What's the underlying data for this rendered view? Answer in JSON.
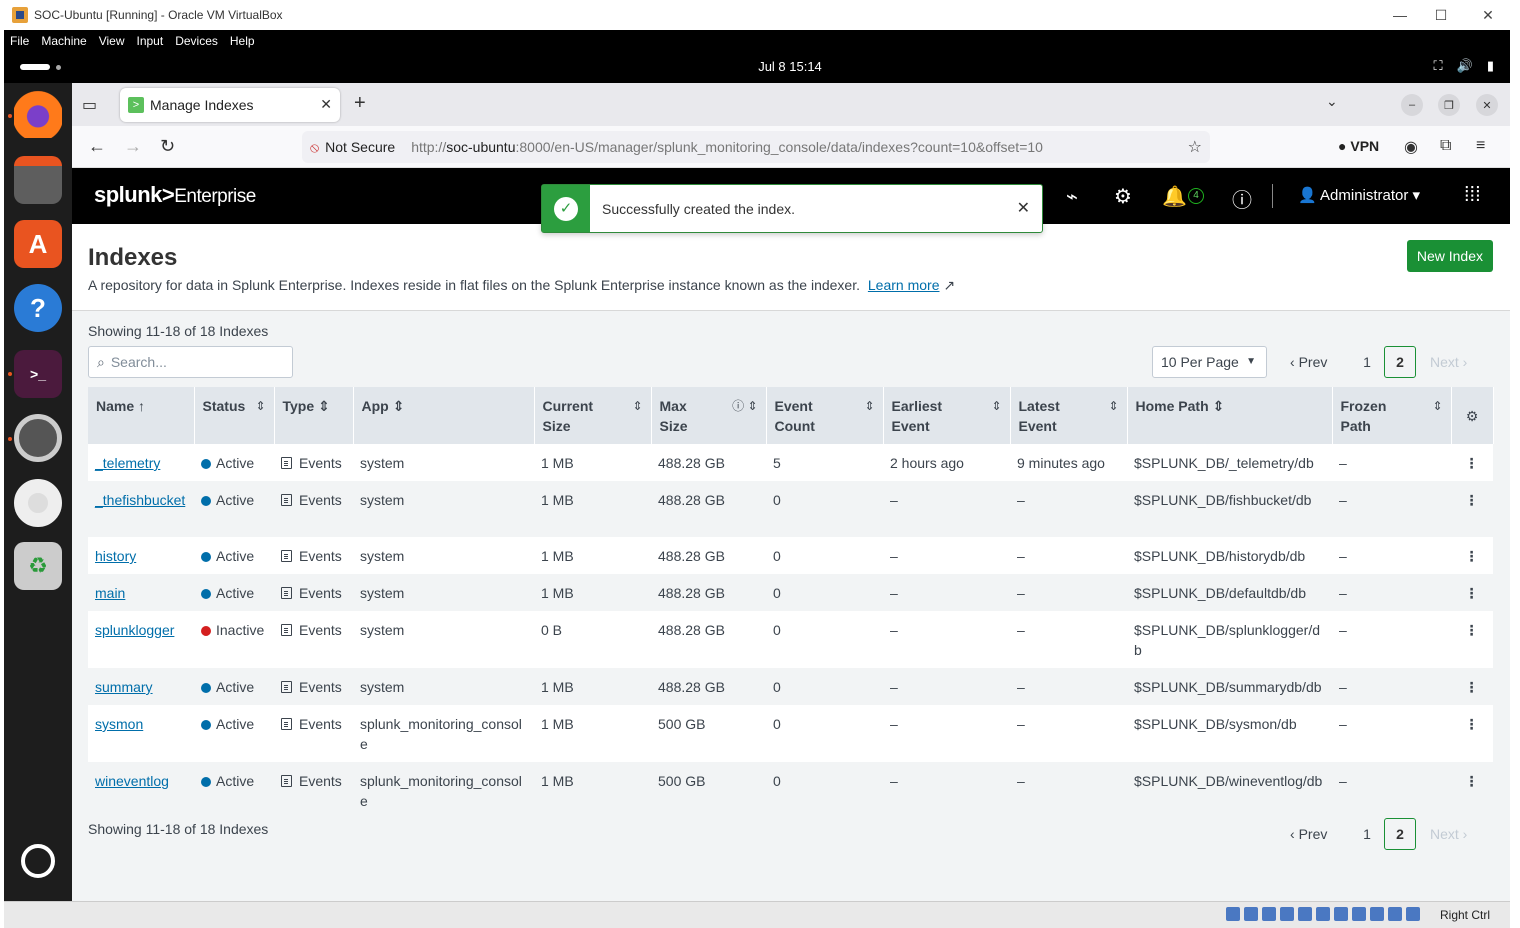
{
  "vbox": {
    "title": "SOC-Ubuntu [Running] - Oracle VM VirtualBox",
    "menu": [
      "File",
      "Machine",
      "View",
      "Input",
      "Devices",
      "Help"
    ],
    "host_key": "Right Ctrl"
  },
  "ubuntu": {
    "clock": "Jul 8  15:14"
  },
  "browser": {
    "tab_title": "Manage Indexes",
    "not_secure": "Not Secure",
    "url_prefix": "http://",
    "url_host": "soc-ubuntu",
    "url_rest": ":8000/en-US/manager/splunk_monitoring_console/data/indexes?count=10&offset=10",
    "vpn_label": "VPN"
  },
  "splunk": {
    "logo_main": "splunk>",
    "logo_product": "Enterprise",
    "notification_count": "4",
    "user": "Administrator"
  },
  "toast": {
    "message": "Successfully created the index."
  },
  "page": {
    "title": "Indexes",
    "description": "A repository for data in Splunk Enterprise. Indexes reside in flat files on the Splunk Enterprise instance known as the indexer.",
    "learn_more": "Learn more",
    "new_index": "New Index",
    "showing": "Showing 11-18 of 18 Indexes",
    "search_placeholder": "Search...",
    "per_page": "10 Per Page",
    "pager": {
      "prev": "Prev",
      "page1": "1",
      "page2": "2",
      "next": "Next"
    }
  },
  "table": {
    "headers": [
      "Name",
      "Status",
      "Type",
      "App",
      "Current Size",
      "Max Size",
      "Event Count",
      "Earliest Event",
      "Latest Event",
      "Home Path",
      "Frozen Path"
    ],
    "rows": [
      {
        "name": "_telemetry",
        "status": "Active",
        "active": true,
        "type": "Events",
        "app": "system",
        "current_size": "1 MB",
        "max_size": "488.28 GB",
        "event_count": "5",
        "earliest": "2 hours ago",
        "latest": "9 minutes ago",
        "home_path": "$SPLUNK_DB/_telemetry/db",
        "frozen_path": "–"
      },
      {
        "name": "_thefishbucket",
        "status": "Active",
        "active": true,
        "type": "Events",
        "app": "system",
        "current_size": "1 MB",
        "max_size": "488.28 GB",
        "event_count": "0",
        "earliest": "–",
        "latest": "–",
        "home_path": "$SPLUNK_DB/fishbucket/db",
        "frozen_path": "–"
      },
      {
        "name": "history",
        "status": "Active",
        "active": true,
        "type": "Events",
        "app": "system",
        "current_size": "1 MB",
        "max_size": "488.28 GB",
        "event_count": "0",
        "earliest": "–",
        "latest": "–",
        "home_path": "$SPLUNK_DB/historydb/db",
        "frozen_path": "–"
      },
      {
        "name": "main",
        "status": "Active",
        "active": true,
        "type": "Events",
        "app": "system",
        "current_size": "1 MB",
        "max_size": "488.28 GB",
        "event_count": "0",
        "earliest": "–",
        "latest": "–",
        "home_path": "$SPLUNK_DB/defaultdb/db",
        "frozen_path": "–"
      },
      {
        "name": "splunklogger",
        "status": "Inactive",
        "active": false,
        "type": "Events",
        "app": "system",
        "current_size": "0 B",
        "max_size": "488.28 GB",
        "event_count": "0",
        "earliest": "–",
        "latest": "–",
        "home_path": "$SPLUNK_DB/splunklogger/db",
        "frozen_path": "–"
      },
      {
        "name": "summary",
        "status": "Active",
        "active": true,
        "type": "Events",
        "app": "system",
        "current_size": "1 MB",
        "max_size": "488.28 GB",
        "event_count": "0",
        "earliest": "–",
        "latest": "–",
        "home_path": "$SPLUNK_DB/summarydb/db",
        "frozen_path": "–"
      },
      {
        "name": "sysmon",
        "status": "Active",
        "active": true,
        "type": "Events",
        "app": "splunk_monitoring_console",
        "current_size": "1 MB",
        "max_size": "500 GB",
        "event_count": "0",
        "earliest": "–",
        "latest": "–",
        "home_path": "$SPLUNK_DB/sysmon/db",
        "frozen_path": "–"
      },
      {
        "name": "wineventlog",
        "status": "Active",
        "active": true,
        "type": "Events",
        "app": "splunk_monitoring_console",
        "current_size": "1 MB",
        "max_size": "500 GB",
        "event_count": "0",
        "earliest": "–",
        "latest": "–",
        "home_path": "$SPLUNK_DB/wineventlog/db",
        "frozen_path": "–"
      }
    ]
  },
  "colors": {
    "active": "#006eaa",
    "inactive": "#d41f1f",
    "accent_green": "#1a9035"
  }
}
